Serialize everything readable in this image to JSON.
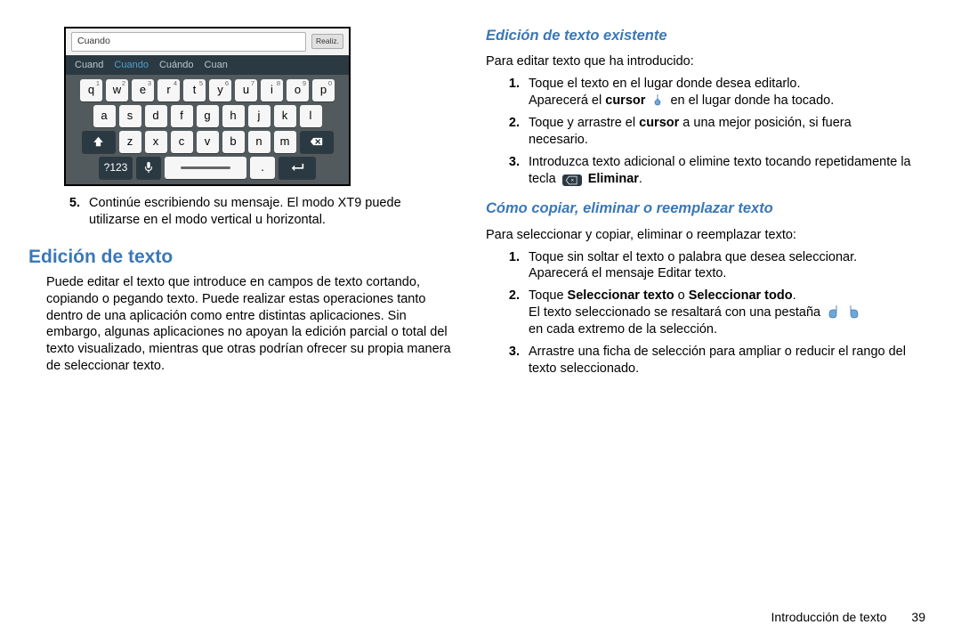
{
  "keyboard": {
    "input_word": "Cuando",
    "input_button": "Realiz.",
    "suggestions": [
      "Cuand",
      "Cuando",
      "Cuándo",
      "Cuan"
    ],
    "row1": [
      {
        "k": "q",
        "n": "1"
      },
      {
        "k": "w",
        "n": "2"
      },
      {
        "k": "e",
        "n": "3"
      },
      {
        "k": "r",
        "n": "4"
      },
      {
        "k": "t",
        "n": "5"
      },
      {
        "k": "y",
        "n": "6"
      },
      {
        "k": "u",
        "n": "7"
      },
      {
        "k": "i",
        "n": "8"
      },
      {
        "k": "o",
        "n": "9"
      },
      {
        "k": "p",
        "n": "0"
      }
    ],
    "row2": [
      "a",
      "s",
      "d",
      "f",
      "g",
      "h",
      "j",
      "k",
      "l"
    ],
    "row3": [
      "z",
      "x",
      "c",
      "v",
      "b",
      "n",
      "m"
    ],
    "sym": "?123",
    "period": "."
  },
  "left": {
    "step5_num": "5.",
    "step5_txt": "Continúe escribiendo su mensaje. El modo XT9 puede utilizarse en el modo vertical u horizontal.",
    "h_edit": "Edición de texto",
    "edit_body": "Puede editar el texto que introduce en campos de texto cortando, copiando o pegando texto. Puede realizar estas operaciones tanto dentro de una aplicación como entre distintas aplicaciones. Sin embargo, algunas aplicaciones no apoyan la edición parcial o total del texto visualizado, mientras que otras podrían ofrecer su propia manera de seleccionar texto."
  },
  "right": {
    "h_existing": "Edición de texto existente",
    "intro_existing": "Para editar texto que ha introducido:",
    "ex1_num": "1.",
    "ex1a": "Toque el texto en el lugar donde desea editarlo.",
    "ex1b_pre": "Aparecerá el ",
    "ex1b_cursor": "cursor",
    "ex1b_post": " en el lugar donde ha tocado.",
    "ex2_num": "2.",
    "ex2a_pre": "Toque y arrastre el ",
    "ex2a_bold": "cursor",
    "ex2a_post": " a una mejor posición, si fuera necesario.",
    "ex3_num": "3.",
    "ex3a": "Introduzca texto adicional o elimine texto tocando repetidamente la tecla ",
    "ex3b_bold": "Eliminar",
    "ex3b_period": ".",
    "h_copy": "Cómo copiar, eliminar o reemplazar texto",
    "intro_copy": "Para seleccionar y copiar, eliminar o reemplazar texto:",
    "c1_num": "1.",
    "c1a": "Toque sin soltar el texto o palabra que desea seleccionar.",
    "c1b": "Aparecerá el mensaje Editar texto.",
    "c2_num": "2.",
    "c2a_pre": "Toque ",
    "c2a_b1": "Seleccionar texto",
    "c2a_mid": " o ",
    "c2a_b2": "Seleccionar todo",
    "c2a_post": ".",
    "c2b_pre": "El texto seleccionado se resaltará con una pestaña ",
    "c2b_post": " en cada extremo de la selección.",
    "c3_num": "3.",
    "c3a": "Arrastre una ficha de selección para ampliar o reducir el rango del texto seleccionado."
  },
  "footer": {
    "section": "Introducción de texto",
    "page": "39"
  }
}
